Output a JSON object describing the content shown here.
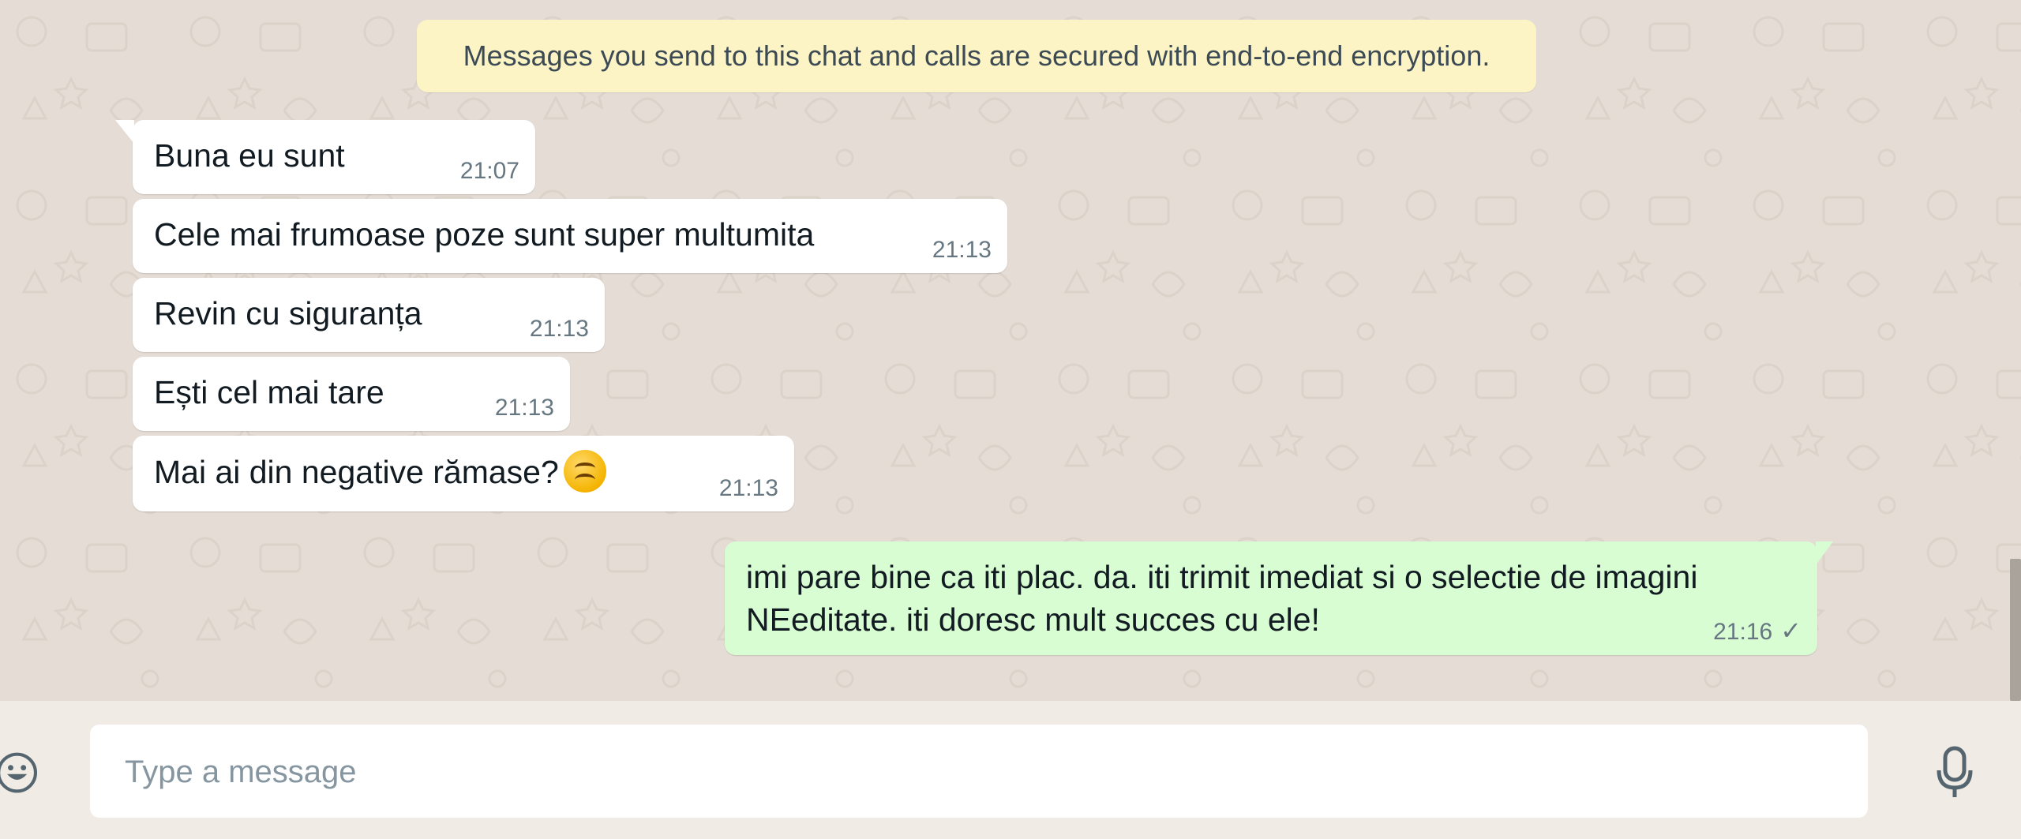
{
  "encryption_notice": "Messages you send to this chat and calls are secured with end-to-end encryption.",
  "messages": [
    {
      "direction": "incoming",
      "text": "Buna eu sunt",
      "time": "21:07"
    },
    {
      "direction": "incoming",
      "text": "Cele mai frumoase poze sunt super multumita",
      "time": "21:13"
    },
    {
      "direction": "incoming",
      "text": "Revin cu siguranța",
      "time": "21:13"
    },
    {
      "direction": "incoming",
      "text": "Ești cel mai tare",
      "time": "21:13"
    },
    {
      "direction": "incoming",
      "text": "Mai ai din negative rămase?",
      "time": "21:13",
      "emoji": "upside-down-face"
    },
    {
      "direction": "outgoing",
      "text": "imi pare bine ca iti plac. da. iti trimit imediat si o selectie de imagini NEeditate. iti doresc mult succes cu ele!",
      "time": "21:16",
      "status": "sent"
    }
  ],
  "composer": {
    "placeholder": "Type a message",
    "emoji_icon": "smiley-icon",
    "mic_icon": "microphone-icon"
  },
  "colors": {
    "chat_background": "#e5ddd5",
    "incoming_bubble": "#ffffff",
    "outgoing_bubble": "#d9fdd3",
    "notice_background": "#fdf4c5"
  }
}
